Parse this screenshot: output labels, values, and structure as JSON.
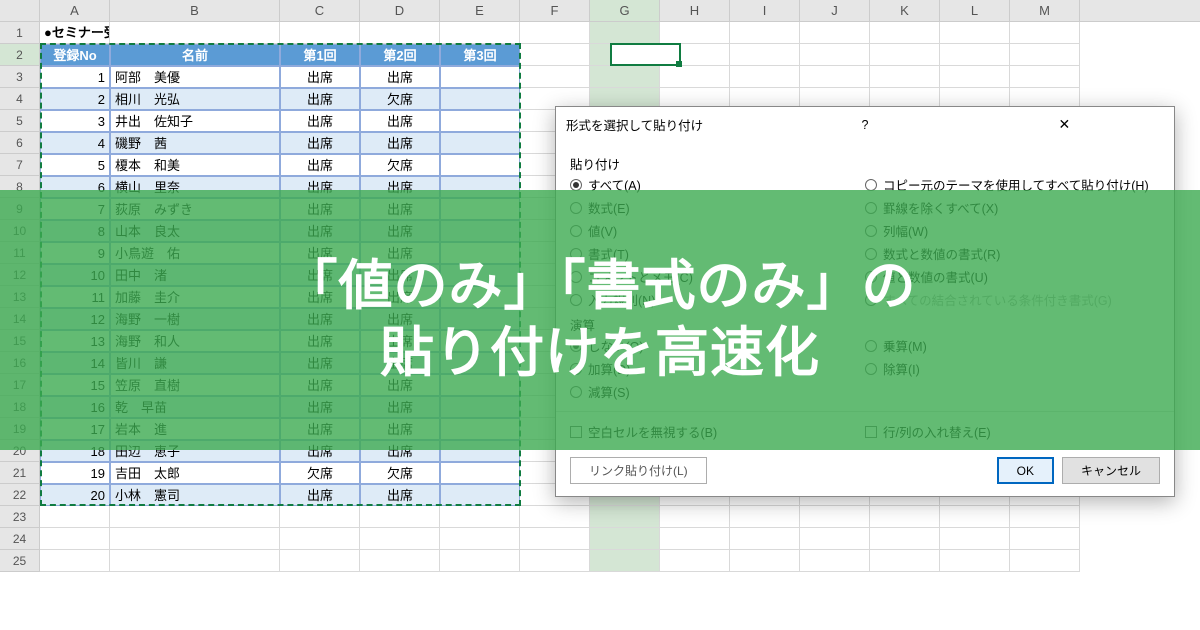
{
  "columns": [
    "A",
    "B",
    "C",
    "D",
    "E",
    "F",
    "G",
    "H",
    "I",
    "J",
    "K",
    "L",
    "M"
  ],
  "title": "●セミナー受講者名簿",
  "headers": {
    "no": "登録No",
    "name": "名前",
    "r1": "第1回",
    "r2": "第2回",
    "r3": "第3回"
  },
  "rows": [
    {
      "n": "1",
      "name": "阿部　美優",
      "r1": "出席",
      "r2": "出席",
      "r3": ""
    },
    {
      "n": "2",
      "name": "相川　光弘",
      "r1": "出席",
      "r2": "欠席",
      "r3": ""
    },
    {
      "n": "3",
      "name": "井出　佐知子",
      "r1": "出席",
      "r2": "出席",
      "r3": ""
    },
    {
      "n": "4",
      "name": "磯野　茜",
      "r1": "出席",
      "r2": "出席",
      "r3": ""
    },
    {
      "n": "5",
      "name": "榎本　和美",
      "r1": "出席",
      "r2": "欠席",
      "r3": ""
    },
    {
      "n": "6",
      "name": "横山　里奈",
      "r1": "出席",
      "r2": "出席",
      "r3": ""
    },
    {
      "n": "7",
      "name": "荻原　みずき",
      "r1": "出席",
      "r2": "出席",
      "r3": ""
    },
    {
      "n": "8",
      "name": "山本　良太",
      "r1": "出席",
      "r2": "出席",
      "r3": ""
    },
    {
      "n": "9",
      "name": "小鳥遊　佑",
      "r1": "出席",
      "r2": "出席",
      "r3": ""
    },
    {
      "n": "10",
      "name": "田中　渚",
      "r1": "出席",
      "r2": "出席",
      "r3": ""
    },
    {
      "n": "11",
      "name": "加藤　圭介",
      "r1": "出席",
      "r2": "出席",
      "r3": ""
    },
    {
      "n": "12",
      "name": "海野　一樹",
      "r1": "出席",
      "r2": "出席",
      "r3": ""
    },
    {
      "n": "13",
      "name": "海野　和人",
      "r1": "出席",
      "r2": "出席",
      "r3": ""
    },
    {
      "n": "14",
      "name": "皆川　謙",
      "r1": "出席",
      "r2": "出席",
      "r3": ""
    },
    {
      "n": "15",
      "name": "笠原　直樹",
      "r1": "出席",
      "r2": "出席",
      "r3": ""
    },
    {
      "n": "16",
      "name": "乾　早苗",
      "r1": "出席",
      "r2": "出席",
      "r3": ""
    },
    {
      "n": "17",
      "name": "岩本　進",
      "r1": "出席",
      "r2": "出席",
      "r3": ""
    },
    {
      "n": "18",
      "name": "田辺　恵子",
      "r1": "出席",
      "r2": "出席",
      "r3": ""
    },
    {
      "n": "19",
      "name": "吉田　太郎",
      "r1": "欠席",
      "r2": "欠席",
      "r3": ""
    },
    {
      "n": "20",
      "name": "小林　憲司",
      "r1": "出席",
      "r2": "出席",
      "r3": ""
    }
  ],
  "dialog": {
    "title": "形式を選択して貼り付け",
    "section_paste": "貼り付け",
    "left_paste": [
      "すべて(A)",
      "数式(E)",
      "値(V)",
      "書式(T)",
      "コメントとメモ(C)",
      "入力規則(N)"
    ],
    "right_paste": [
      "コピー元のテーマを使用してすべて貼り付け(H)",
      "罫線を除くすべて(X)",
      "列幅(W)",
      "数式と数値の書式(R)",
      "値と数値の書式(U)",
      "すべての結合されている条件付き書式(G)"
    ],
    "section_op": "演算",
    "left_op": [
      "しない(O)",
      "加算(D)",
      "減算(S)"
    ],
    "right_op": [
      "乗算(M)",
      "除算(I)"
    ],
    "blank": "空白セルを無視する(B)",
    "transpose": "行/列の入れ替え(E)",
    "link": "リンク貼り付け(L)",
    "ok": "OK",
    "cancel": "キャンセル"
  },
  "overlay": {
    "line1": "「値のみ」「書式のみ」の",
    "line2": "貼り付けを高速化"
  }
}
